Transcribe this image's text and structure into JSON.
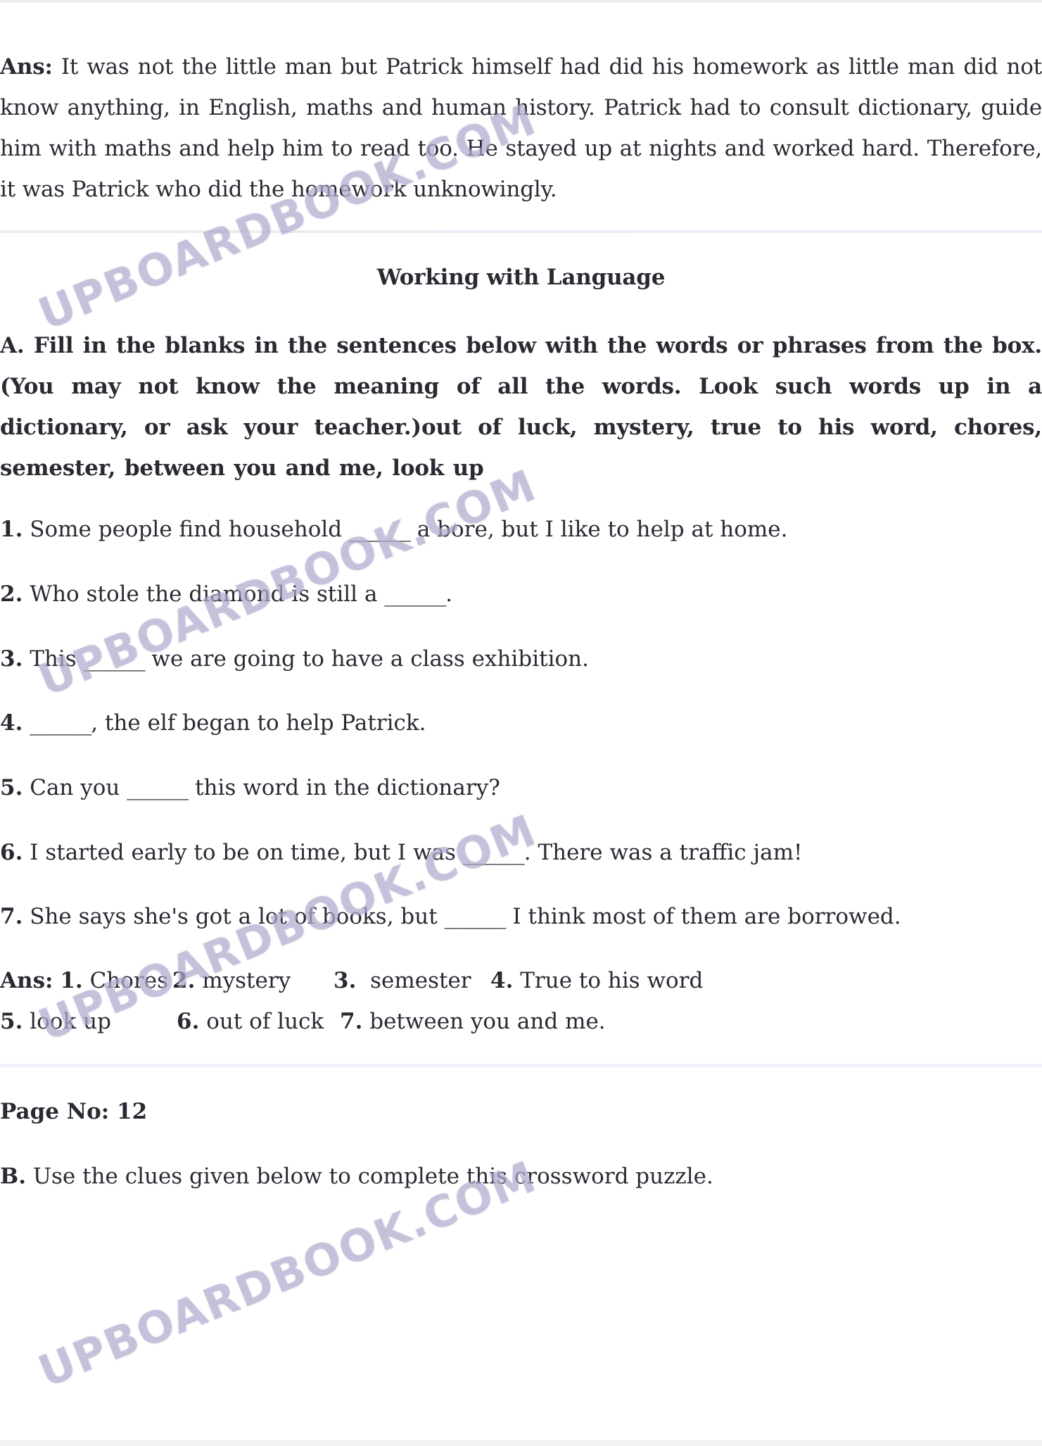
{
  "answer_paragraph": {
    "label": "Ans:",
    "text": " It was not the little man but Patrick himself had did his homework as little man did not know anything, in English, maths and human history. Patrick had to consult dictionary, guide him with maths and help him to read too. He stayed up at nights and worked hard. Therefore, it was Patrick who did the homework unknowingly."
  },
  "section_heading": "Working with Language",
  "exercise_a": {
    "instruction": "A. Fill in the blanks in the sentences below with the words or phrases from the box. (You may not know the meaning of all the words. Look such words up in a dictionary, or ask your teacher.)out of luck, mystery, true to his word, chores, semester, between you and me, look up",
    "questions": [
      {
        "num": "1.",
        "before": " Some people find household ",
        "blank": "______",
        "after": " a bore, but I like to help at home."
      },
      {
        "num": "2.",
        "before": " Who stole the diamond is still a ",
        "blank": "______",
        "after": "."
      },
      {
        "num": "3.",
        "before": " This ",
        "blank": "______",
        "after": " we are going to have a class exhibition."
      },
      {
        "num": "4.",
        "before": " ",
        "blank": "______",
        "after": ", the elf began to help Patrick."
      },
      {
        "num": "5.",
        "before": " Can you ",
        "blank": "______",
        "after": " this word in the dictionary?"
      },
      {
        "num": "6.",
        "before": " I started early to be on time, but I was ",
        "blank": "______",
        "after": ". There was a traffic jam!"
      },
      {
        "num": "7.",
        "before": " She says she's got a lot of books, but ",
        "blank": "______",
        "after": " I think most of them are borrowed."
      }
    ],
    "answers": {
      "label": "Ans:",
      "items": [
        {
          "num": "1.",
          "text": " Chores"
        },
        {
          "num": "2.",
          "text": " mystery"
        },
        {
          "num": "3.",
          "text": "  semester"
        },
        {
          "num": "4.",
          "text": " True to his word"
        },
        {
          "num": "5.",
          "text": " look up"
        },
        {
          "num": "6.",
          "text": " out of luck"
        },
        {
          "num": "7.",
          "text": " between you and me."
        }
      ]
    }
  },
  "page_number": {
    "label": "Page No:",
    "value": " 12"
  },
  "exercise_b": {
    "label": "B.",
    "text": " Use the clues given below to complete this crossword puzzle."
  },
  "watermark_text": "UPBOARDBOOK.COM",
  "colors": {
    "text": "#2b2a33",
    "watermark": "#b4b0cf",
    "rule": "#ececec"
  }
}
